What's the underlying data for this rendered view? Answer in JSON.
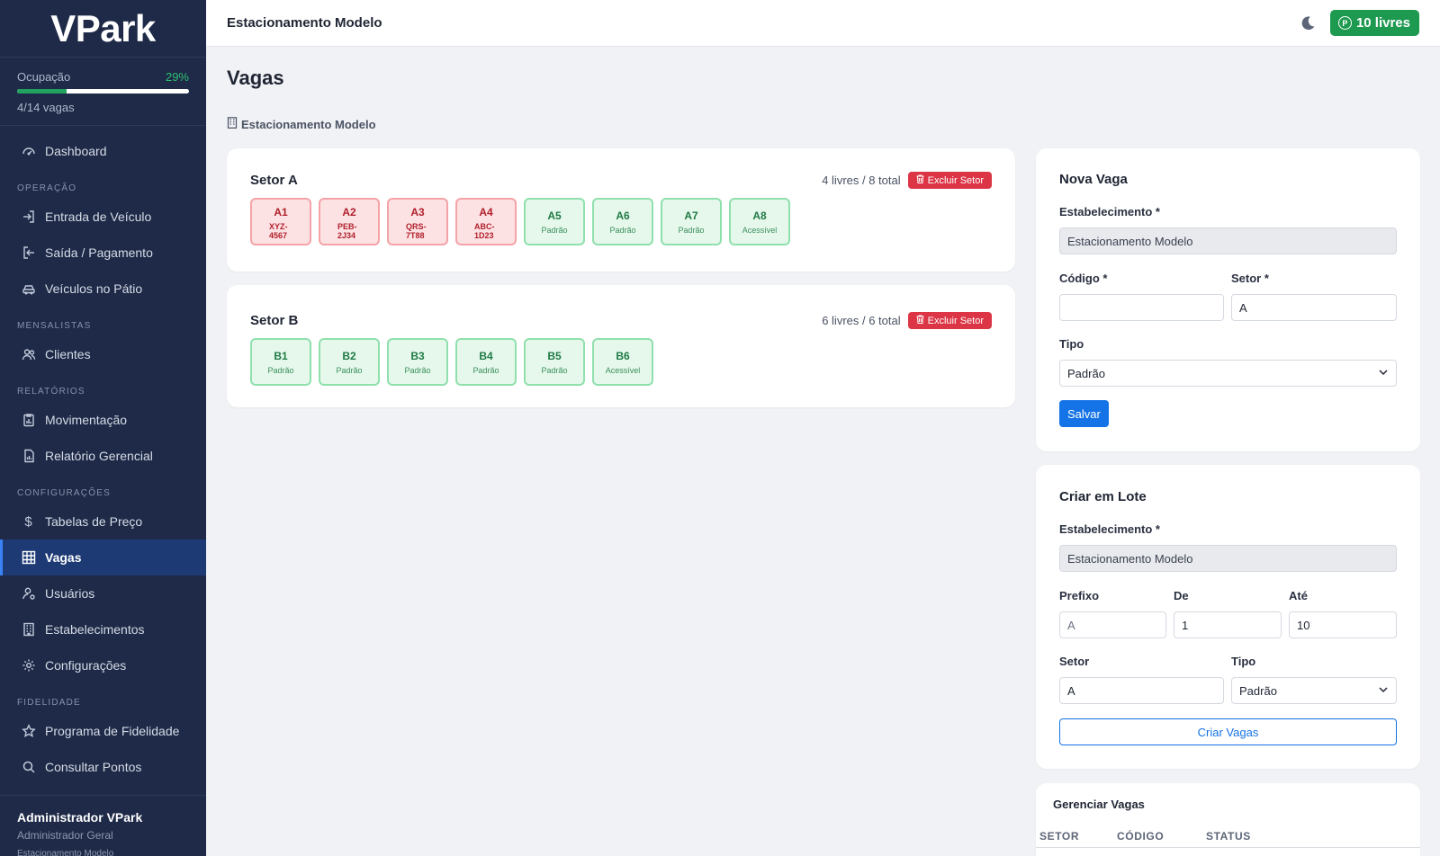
{
  "sidebar": {
    "logo": "VPark",
    "occupancy": {
      "label": "Ocupação",
      "percent_text": "29%",
      "fraction": 0.29,
      "count_text": "4/14 vagas"
    },
    "dashboard": "Dashboard",
    "sections": {
      "operacao": "OPERAÇÃO",
      "mensalistas": "MENSALISTAS",
      "relatorios": "RELATÓRIOS",
      "configuracoes": "CONFIGURAÇÕES",
      "fidelidade": "FIDELIDADE"
    },
    "items": {
      "entrada": "Entrada de Veículo",
      "saida": "Saída / Pagamento",
      "patio": "Veículos no Pátio",
      "clientes": "Clientes",
      "movimentacao": "Movimentação",
      "relatorio": "Relatório Gerencial",
      "tabelas": "Tabelas de Preço",
      "vagas": "Vagas",
      "usuarios": "Usuários",
      "estabelecimentos": "Estabelecimentos",
      "configuracoes": "Configurações",
      "fidelidade": "Programa de Fidelidade",
      "pontos": "Consultar Pontos"
    },
    "user": {
      "name": "Administrador VPark",
      "role": "Administrador Geral",
      "establishment": "Estacionamento Modelo"
    }
  },
  "topbar": {
    "title": "Estacionamento Modelo",
    "free_badge": "10 livres",
    "p_icon": "P"
  },
  "main": {
    "title": "Vagas",
    "establishment": "Estacionamento Modelo",
    "sectors": [
      {
        "name": "Setor A",
        "info": "4 livres / 8 total",
        "delete_label": "Excluir Setor",
        "spots": [
          {
            "code": "A1",
            "sub": "XYZ-4567",
            "status": "occ"
          },
          {
            "code": "A2",
            "sub": "PEB-2J34",
            "status": "occ"
          },
          {
            "code": "A3",
            "sub": "QRS-7T88",
            "status": "occ"
          },
          {
            "code": "A4",
            "sub": "ABC-1D23",
            "status": "occ"
          },
          {
            "code": "A5",
            "sub": "Padrão",
            "status": "free"
          },
          {
            "code": "A6",
            "sub": "Padrão",
            "status": "free"
          },
          {
            "code": "A7",
            "sub": "Padrão",
            "status": "free"
          },
          {
            "code": "A8",
            "sub": "Acessível",
            "status": "free"
          }
        ]
      },
      {
        "name": "Setor B",
        "info": "6 livres / 6 total",
        "delete_label": "Excluir Setor",
        "spots": [
          {
            "code": "B1",
            "sub": "Padrão",
            "status": "free"
          },
          {
            "code": "B2",
            "sub": "Padrão",
            "status": "free"
          },
          {
            "code": "B3",
            "sub": "Padrão",
            "status": "free"
          },
          {
            "code": "B4",
            "sub": "Padrão",
            "status": "free"
          },
          {
            "code": "B5",
            "sub": "Padrão",
            "status": "free"
          },
          {
            "code": "B6",
            "sub": "Acessível",
            "status": "free"
          }
        ]
      }
    ]
  },
  "nova_vaga": {
    "title": "Nova Vaga",
    "est_label": "Estabelecimento *",
    "est_value": "Estacionamento Modelo",
    "codigo_label": "Código *",
    "codigo_value": "",
    "setor_label": "Setor *",
    "setor_value": "A",
    "tipo_label": "Tipo",
    "tipo_value": "Padrão",
    "save": "Salvar"
  },
  "lote": {
    "title": "Criar em Lote",
    "est_label": "Estabelecimento *",
    "est_value": "Estacionamento Modelo",
    "prefixo_label": "Prefixo",
    "prefixo_value": "A",
    "de_label": "De",
    "de_value": "1",
    "ate_label": "Até",
    "ate_value": "10",
    "setor_label": "Setor",
    "setor_value": "A",
    "tipo_label": "Tipo",
    "tipo_value": "Padrão",
    "create": "Criar Vagas"
  },
  "gerenciar": {
    "title": "Gerenciar Vagas",
    "columns": [
      "SETOR",
      "CÓDIGO",
      "STATUS"
    ]
  },
  "colors": {
    "sidebar": "#1e2a47",
    "accent": "#1473e6",
    "success": "#1e9a50",
    "danger": "#dc3545"
  }
}
